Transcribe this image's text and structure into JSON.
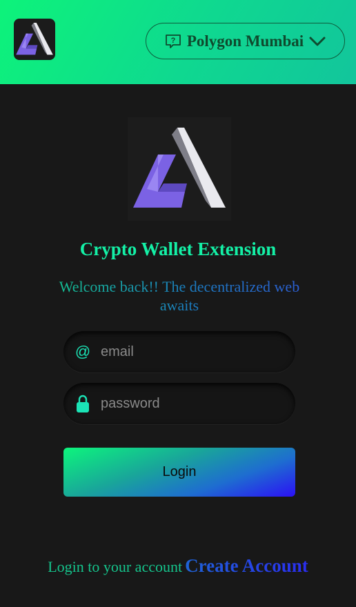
{
  "header": {
    "network": {
      "label": "Polygon Mumbai",
      "icon": "network-help-icon"
    }
  },
  "main": {
    "title": "Crypto Wallet Extension",
    "subtitle": "Welcome back!! The decentralized web awaits",
    "email": {
      "placeholder": "email",
      "value": "",
      "icon": "at-icon"
    },
    "password": {
      "placeholder": "password",
      "value": "",
      "icon": "lock-icon"
    },
    "login_label": "Login"
  },
  "footer": {
    "prompt": "Login to your account",
    "create_label": "Create Account"
  },
  "colors": {
    "accent_green": "#14f0a6",
    "background": "#181818",
    "accent_blue": "#2b10f6"
  }
}
